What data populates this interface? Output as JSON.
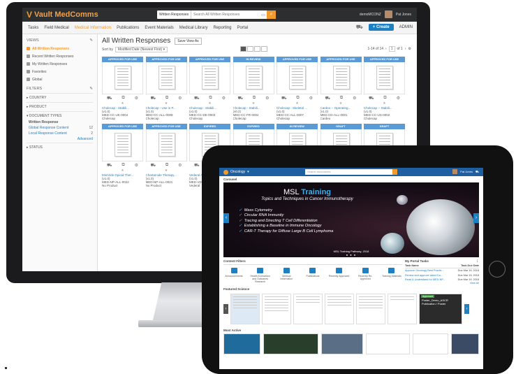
{
  "desktop": {
    "logo": "Vault MedComms",
    "search": {
      "scope": "Written Responses",
      "placeholder": "Search All Written Responses"
    },
    "user": {
      "email": "demoMCONZ",
      "name": "Pat Jones"
    },
    "nav": {
      "items": [
        "Tasks",
        "Field Medical",
        "Medical Information",
        "Publications",
        "Event Materials",
        "Medical Library",
        "Reporting",
        "Portal"
      ],
      "active": "Medical Information",
      "create_label": "+ Create",
      "admin_label": "ADMIN"
    },
    "sidebar": {
      "views_header": "VIEWS",
      "views": [
        "All Written Responses",
        "Recent Written Responses",
        "My Written Responses",
        "Favorites",
        "Global"
      ],
      "filters_header": "FILTERS",
      "filters": [
        "COUNTRY",
        "PRODUCT",
        "DOCUMENT TYPES"
      ],
      "doc_type_parent": "Written Response",
      "doc_types": [
        {
          "label": "Global Response Content",
          "count": "12"
        },
        {
          "label": "Local Response Content",
          "count": "2"
        }
      ],
      "advanced": "Advanced",
      "status": "STATUS"
    },
    "main": {
      "title": "All Written Responses",
      "save_view": "Save View As",
      "sort_label": "Sort by",
      "sort_value": "Modified Date (Newest First)",
      "pager": {
        "range": "1-14 of 14",
        "page": "1",
        "of": "of 1"
      }
    },
    "cards": [
      {
        "status": "APPROVED FOR USE",
        "name": "Cholecap - Stabili...",
        "version": "(v1.0)",
        "code": "MED-CC-UK-0004",
        "product": "Cholecap"
      },
      {
        "status": "APPROVED FOR USE",
        "name": "Cholecap - Use in P...",
        "version": "(v1.0)",
        "code": "MED-CC-ALL-0008",
        "product": "Cholecap"
      },
      {
        "status": "APPROVED FOR USE",
        "name": "Cholecap - Stabili...",
        "version": "(v1.0)",
        "code": "MED-CC-DE-0003",
        "product": "Cholecap"
      },
      {
        "status": "IN REVIEW",
        "name": "Cholecap - Stabili...",
        "version": "(v0.2)",
        "code": "MED-CC-FR-0002",
        "product": "Cholecap"
      },
      {
        "status": "APPROVED FOR USE",
        "name": "Cholecap - Skeletal ...",
        "version": "(v1.0)",
        "code": "MED-CC-ALL-0007",
        "product": "Cholecap"
      },
      {
        "status": "APPROVED FOR USE",
        "name": "Cardeo -- Operating...",
        "version": "(v1.0)",
        "code": "MED-CD-ALL-0001",
        "product": "Cardeo"
      },
      {
        "status": "APPROVED FOR USE",
        "name": "Cholecap -- Stabili...",
        "version": "(v1.0)",
        "code": "MED-CC-US-0002",
        "product": "Cholecap"
      },
      {
        "status": "APPROVED FOR USE",
        "name": "MiniVide Opioid Ther...",
        "version": "(v1.0)",
        "code": "MED-NP-ALL-0022",
        "product": "No Product"
      },
      {
        "status": "APPROVED FOR USE",
        "name": "Chartamide Therapy...",
        "version": "(v1.0)",
        "code": "MED-NP-ALL-0021",
        "product": "No Product"
      },
      {
        "status": "EXPIRED",
        "name": "Vederal Adult...",
        "version": "(v1.0)",
        "code": "MED-VDD-ALL...",
        "product": "Vederal"
      },
      {
        "status": "EXPIRED",
        "name": "",
        "version": "",
        "code": "",
        "product": ""
      },
      {
        "status": "IN REVIEW",
        "name": "",
        "version": "",
        "code": "",
        "product": ""
      },
      {
        "status": "DRAFT",
        "name": "",
        "version": "",
        "code": "",
        "product": ""
      },
      {
        "status": "DRAFT",
        "name": "",
        "version": "",
        "code": "",
        "product": ""
      }
    ],
    "status_colors": {
      "APPROVED FOR USE": "#5b9bd5",
      "IN REVIEW": "#5b9bd5",
      "EXPIRED": "#5b9bd5",
      "DRAFT": "#5b9bd5"
    }
  },
  "tablet": {
    "app": "Oncology",
    "search_placeholder": "Search documents",
    "user": "Pat Jones",
    "carousel_label": "Carousel",
    "banner": {
      "title_prefix": "MSL",
      "title_accent": "Training",
      "subtitle": "Topics and Techniques in Cancer Immunotherapy",
      "bullets": [
        "Mass Cytometry",
        "Circular RNA Immunity",
        "Tracing and Directing T Cell Differentiation",
        "Establishing a Baseline in Immune Oncology",
        "CAR-T Therapy for Diffuse Large B Cell Lymphoma"
      ],
      "caption": "MSL Training Pathway, 2018"
    },
    "content_filters": {
      "header": "Content Filters",
      "items": [
        "Announcements",
        "Health Economics and Outcomes Research",
        "Medical Information",
        "Publications",
        "Recently Approved",
        "Recently Re-Approved",
        "Training Materials"
      ]
    },
    "tasks": {
      "header": "My Portal Tasks",
      "col_name": "Task Name",
      "col_date": "Task Due Date",
      "rows": [
        {
          "name": "Approve Oncology Best Practic...",
          "date": "Due Mar 19, 2018"
        },
        {
          "name": "Review and approve latest Ca...",
          "date": "Due Mar 19, 2018"
        },
        {
          "name": "Read & Understand for MED-NP...",
          "date": "Due Mar 19, 2018"
        }
      ],
      "view_all": "View All"
    },
    "featured_label": "Featured Science",
    "featured_dark": {
      "badge": "Approved",
      "title": "Poster_Demo_ASCR",
      "sub": "Publication / Poster"
    },
    "most_active_label": "Most Active"
  }
}
